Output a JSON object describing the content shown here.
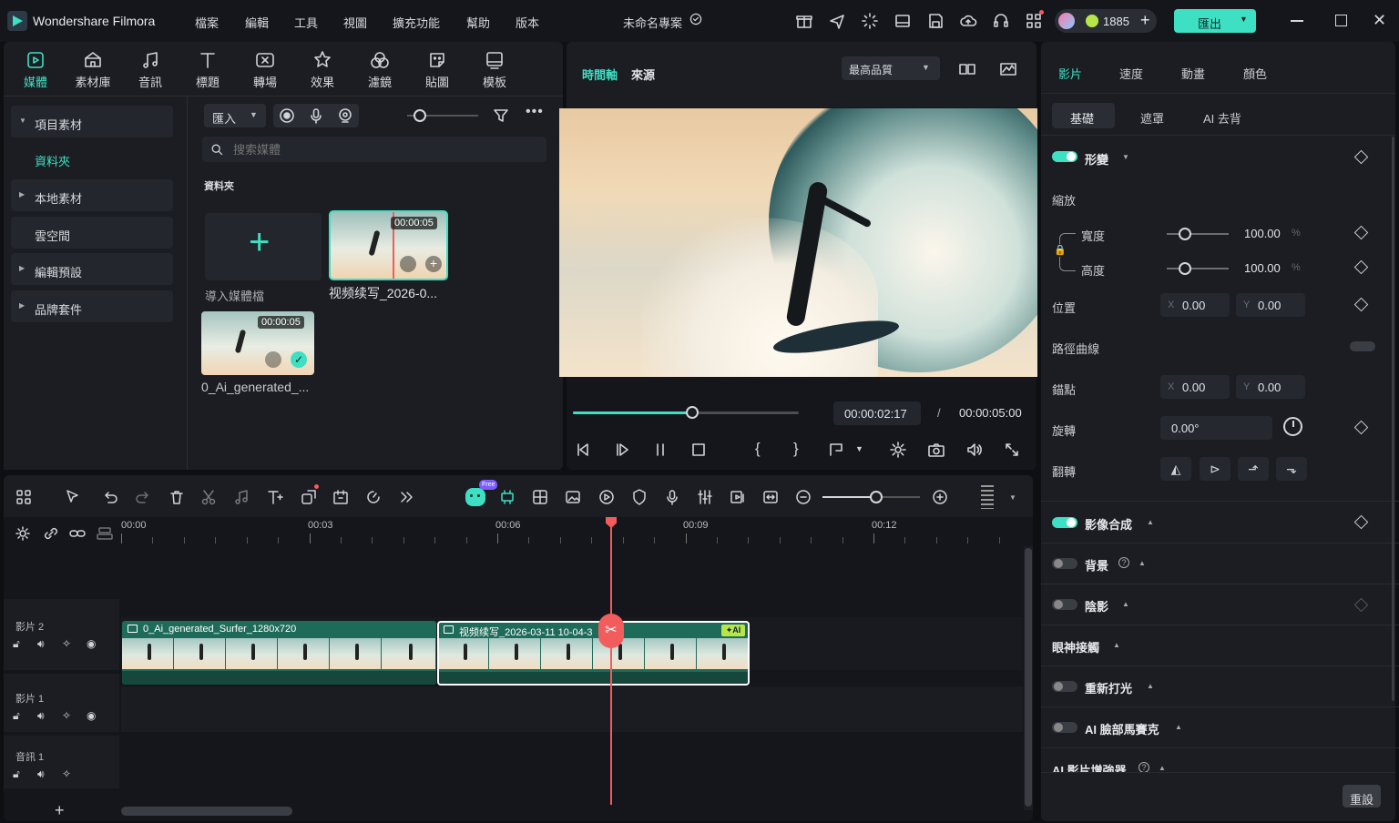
{
  "app": {
    "title": "Wondershare Filmora",
    "project": "未命名專案",
    "points": "1885",
    "export_label": "匯出"
  },
  "menu": [
    "檔案",
    "編輯",
    "工具",
    "視圖",
    "擴充功能",
    "幫助",
    "版本"
  ],
  "media_tabs": [
    {
      "label": "媒體",
      "icon": "media-icon"
    },
    {
      "label": "素材庫",
      "icon": "library-icon"
    },
    {
      "label": "音訊",
      "icon": "music-icon"
    },
    {
      "label": "標題",
      "icon": "title-icon"
    },
    {
      "label": "轉場",
      "icon": "transition-icon"
    },
    {
      "label": "效果",
      "icon": "effects-icon"
    },
    {
      "label": "濾鏡",
      "icon": "filters-icon"
    },
    {
      "label": "貼圖",
      "icon": "sticker-icon"
    },
    {
      "label": "模板",
      "icon": "template-icon"
    }
  ],
  "sidebar": {
    "items": [
      {
        "label": "項目素材",
        "arrow": "▼"
      },
      {
        "label": "資料夾"
      },
      {
        "label": "本地素材",
        "arrow": "▶"
      },
      {
        "label": "雲空間"
      },
      {
        "label": "編輯預設",
        "arrow": "▶"
      },
      {
        "label": "品牌套件",
        "arrow": "▶"
      }
    ]
  },
  "media": {
    "import_label": "匯入",
    "search_placeholder": "搜索媒體",
    "folder_label": "資料夾",
    "import_media_label": "導入媒體檔",
    "items": [
      {
        "name": "视频续写_2026-0...",
        "duration": "00:00:05"
      },
      {
        "name": "0_Ai_generated_...",
        "duration": "00:00:05"
      }
    ]
  },
  "preview": {
    "tabs": [
      "時間軸",
      "來源"
    ],
    "quality": "最高品質",
    "current_time": "00:00:02:17",
    "total_time": "00:00:05:00",
    "progress": 0.53,
    "separator": "/"
  },
  "props": {
    "tabs": [
      "影片",
      "速度",
      "動畫",
      "顏色"
    ],
    "subtabs": [
      "基礎",
      "遮罩",
      "AI 去背"
    ],
    "transform": "形變",
    "scale": "縮放",
    "width_label": "寬度",
    "width_value": "100.00",
    "height_label": "高度",
    "height_value": "100.00",
    "percent": "%",
    "position": "位置",
    "pos_x": "0.00",
    "pos_y": "0.00",
    "x": "X",
    "y": "Y",
    "path_curve": "路徑曲線",
    "anchor": "錨點",
    "anchor_x": "0.00",
    "anchor_y": "0.00",
    "rotate": "旋轉",
    "rotate_value": "0.00°",
    "flip": "翻轉",
    "compositing": "影像合成",
    "background": "背景",
    "shadow": "陰影",
    "eye_contact": "眼神接觸",
    "relight": "重新打光",
    "face_mosaic": "AI 臉部馬賽克",
    "enhancer": "AI 影片增強器",
    "reset": "重設"
  },
  "timeline": {
    "free_badge": "Free",
    "ticks": [
      "00:00",
      "00:03",
      "00:06",
      "00:09",
      "00:12"
    ],
    "tracks": [
      {
        "label": "影片 2"
      },
      {
        "label": "影片 1"
      },
      {
        "label": "音訊 1"
      }
    ],
    "clips": [
      {
        "name": "0_Ai_generated_Surfer_1280x720"
      },
      {
        "name": "视频续写_2026-03-11 10-04-3",
        "badge": "AI"
      }
    ],
    "add": "+"
  },
  "colors": {
    "accent": "#3ee0c4",
    "playhead": "#f25c5c",
    "clip": "#1f6b5a"
  }
}
